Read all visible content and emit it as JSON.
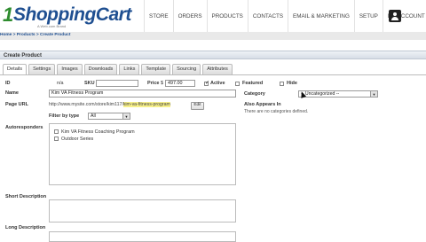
{
  "header": {
    "logo_mark": "1",
    "logo_text": "ShoppingCart",
    "logo_tagline": "A Web.com Brand",
    "nav": [
      "STORE",
      "ORDERS",
      "PRODUCTS",
      "CONTACTS",
      "EMAIL & MARKETING",
      "SETUP",
      "MY ACCOUNT"
    ]
  },
  "breadcrumb": "Home > Products > Create Product",
  "panel_title": "Create Product",
  "tabs": [
    "Details",
    "Settings",
    "Images",
    "Downloads",
    "Links",
    "Template",
    "Sourcing",
    "Attributes"
  ],
  "form": {
    "id_label": "ID",
    "id_value": "n/a",
    "sku_label": "SKU",
    "sku_value": "",
    "price_label": "Price",
    "price_currency": "$",
    "price_value": "497.00",
    "active_label": "Active",
    "active_checked": true,
    "featured_label": "Featured",
    "featured_checked": false,
    "hide_label": "Hide",
    "hide_checked": false,
    "name_label": "Name",
    "name_value": "Kim VA Fitness Program",
    "page_url_label": "Page URL",
    "page_url_prefix": "http://www.mysite.com/store/kim117/",
    "page_url_slug": "kim-va-fitness-program",
    "edit_button": "Edit",
    "filter_label": "Filter by type",
    "filter_value": "All",
    "autoresponders_label": "Autoresponders",
    "autoresponders": [
      "Kim VA Fitness Coaching Program",
      "Outdoor Series"
    ],
    "category_label": "Category",
    "category_value": "-- Uncategorized --",
    "also_appears_label": "Also Appears In",
    "also_appears_text": "There are no categories defined.",
    "short_desc_label": "Short Description",
    "long_desc_label": "Long Description"
  }
}
